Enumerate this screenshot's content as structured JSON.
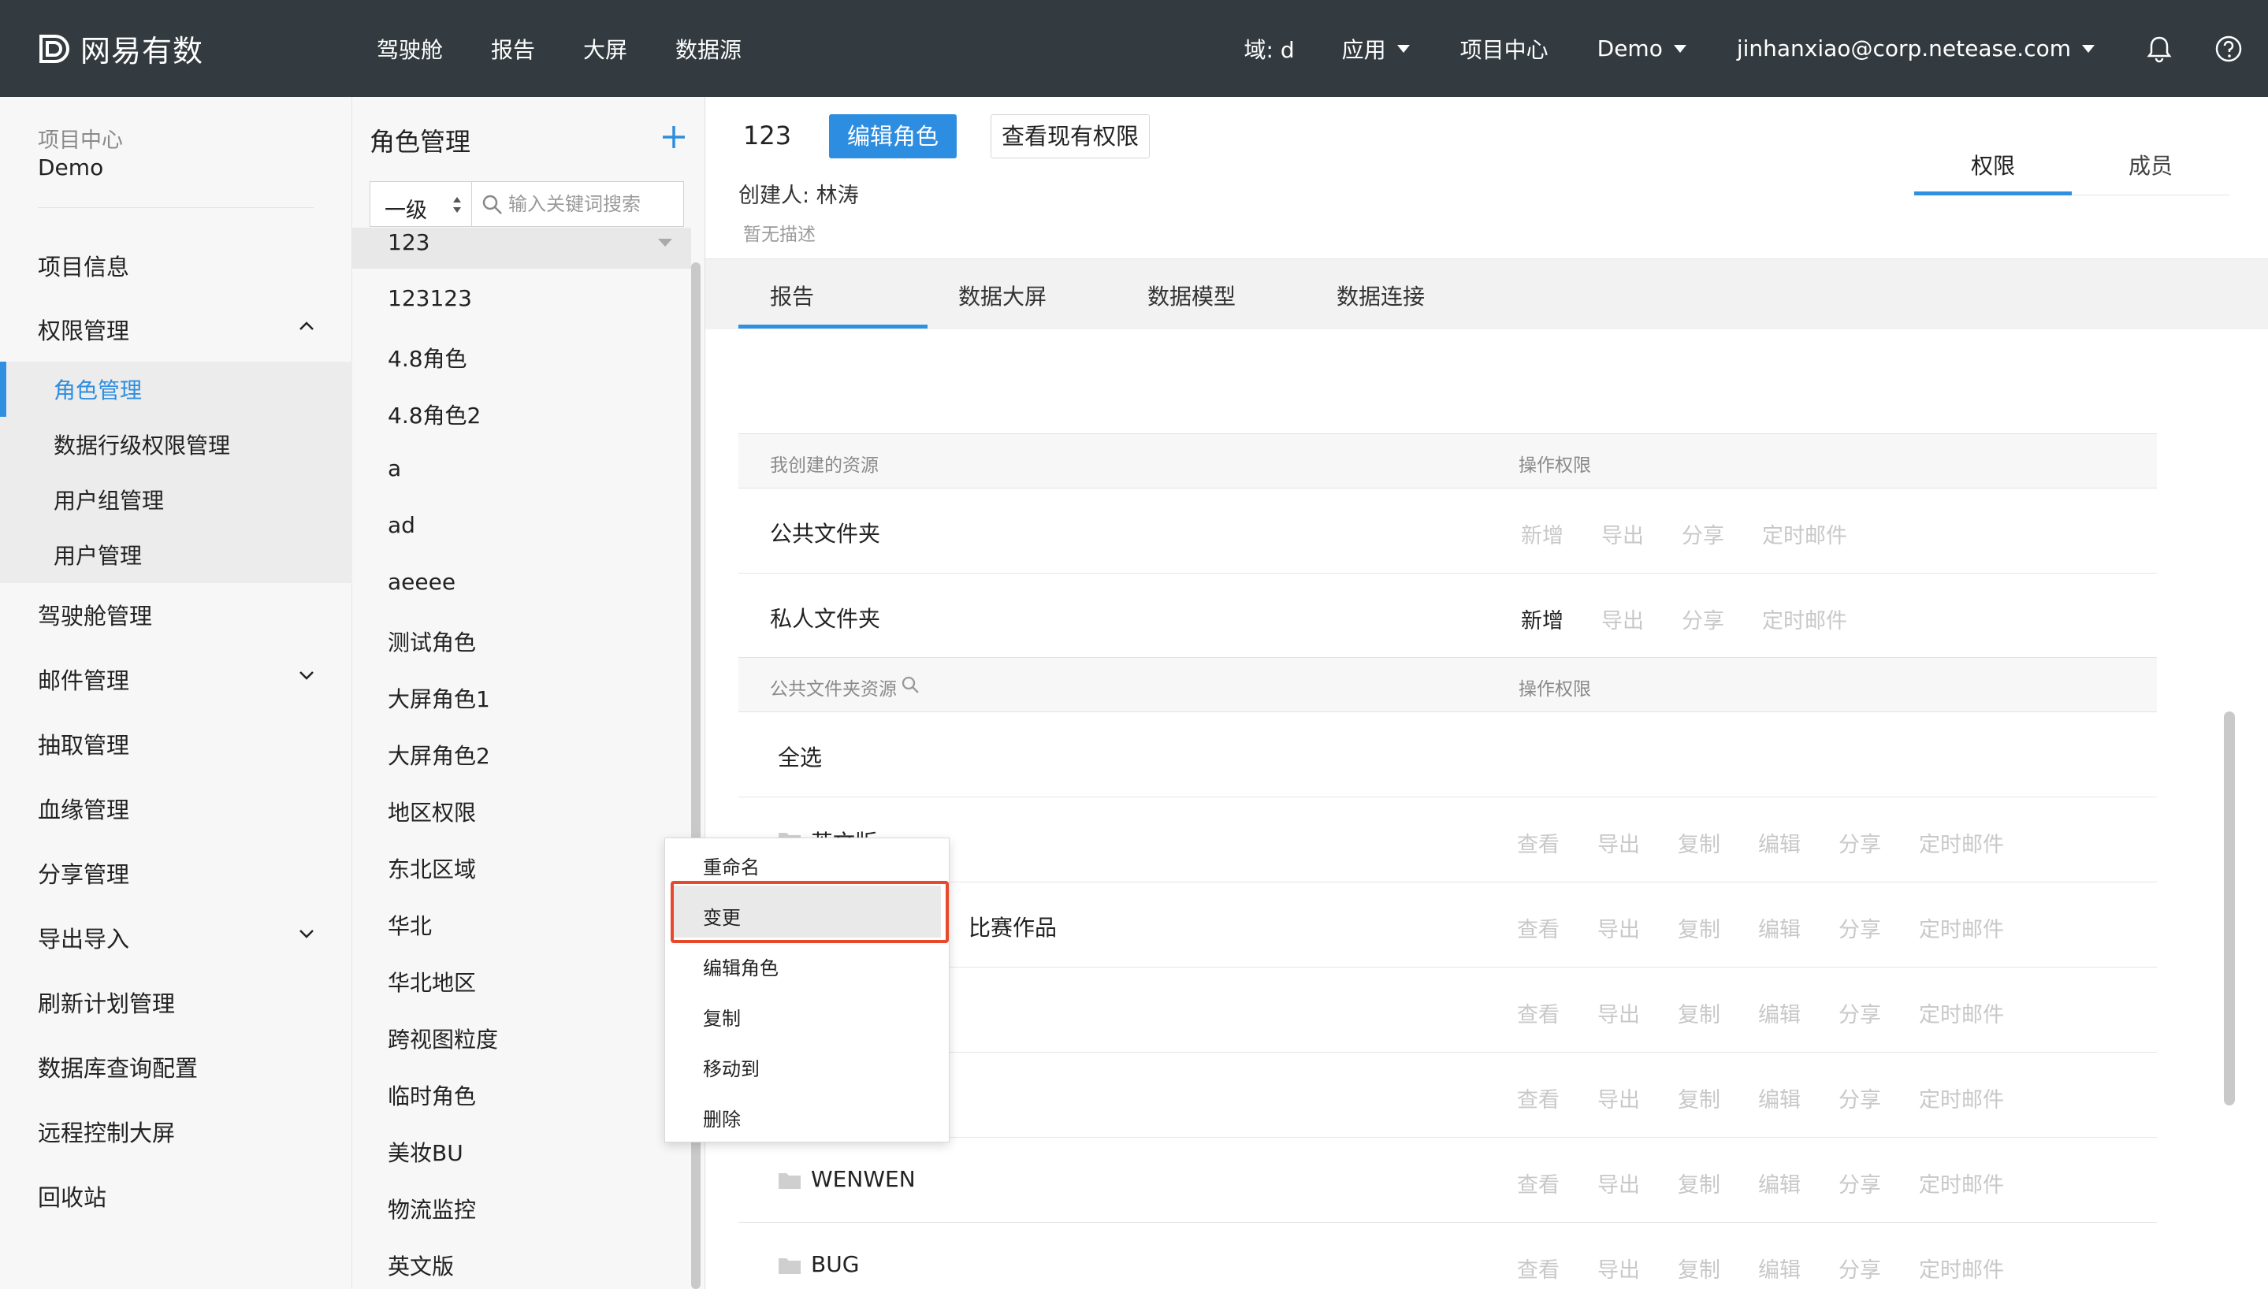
{
  "topbar": {
    "brand": "网易有数",
    "nav": [
      "驾驶舱",
      "报告",
      "大屏",
      "数据源"
    ],
    "domain_label": "域: d",
    "app_label": "应用",
    "project_center": "项目中心",
    "project": "Demo",
    "user_email": "jinhanxiao@corp.netease.com"
  },
  "sidebar": {
    "project_label": "项目中心",
    "project_name": "Demo",
    "items": {
      "project_info": "项目信息",
      "permission": "权限管理",
      "role_mgmt": "角色管理",
      "row_permission": "数据行级权限管理",
      "user_group": "用户组管理",
      "user_mgmt": "用户管理",
      "cockpit_mgmt": "驾驶舱管理",
      "mail_mgmt": "邮件管理",
      "extract_mgmt": "抽取管理",
      "lineage_mgmt": "血缘管理",
      "share_mgmt": "分享管理",
      "export_import": "导出导入",
      "refresh_plan": "刷新计划管理",
      "db_query": "数据库查询配置",
      "remote_screen": "远程控制大屏",
      "recycle": "回收站"
    }
  },
  "roles": {
    "title": "角色管理",
    "level": "一级",
    "search_placeholder": "输入关键词搜索",
    "list": [
      "123",
      "123123",
      "4.8角色",
      "4.8角色2",
      "a",
      "ad",
      "aeeee",
      "测试角色",
      "大屏角色1",
      "大屏角色2",
      "地区权限",
      "东北区域",
      "华北",
      "华北地区",
      "跨视图粒度",
      "临时角色",
      "美妆BU",
      "物流监控",
      "英文版"
    ]
  },
  "main": {
    "role_name": "123",
    "edit_button": "编辑角色",
    "view_button": "查看现有权限",
    "creator": "创建人: 林涛",
    "description": "暂无描述",
    "top_tabs": [
      "权限",
      "成员"
    ],
    "sub_tabs": [
      "报告",
      "数据大屏",
      "数据模型",
      "数据连接"
    ],
    "created_header": "我创建的资源",
    "ops_header": "操作权限",
    "public_folder": "公共文件夹",
    "private_folder": "私人文件夹",
    "public_res_header": "公共文件夹资源",
    "select_all": "全选",
    "folder_ops": [
      "新增",
      "导出",
      "分享",
      "定时邮件"
    ],
    "res_ops": [
      "查看",
      "导出",
      "复制",
      "编辑",
      "分享",
      "定时邮件"
    ],
    "resources": [
      "英文版",
      "比赛作品",
      "",
      "",
      "WENWEN",
      "BUG"
    ]
  },
  "context_menu": {
    "items": [
      "重命名",
      "变更",
      "编辑角色",
      "复制",
      "移动到",
      "删除"
    ],
    "highlight_color": "#e8492c"
  },
  "colors": {
    "accent": "#2d8de0",
    "topbar": "#333b40"
  }
}
